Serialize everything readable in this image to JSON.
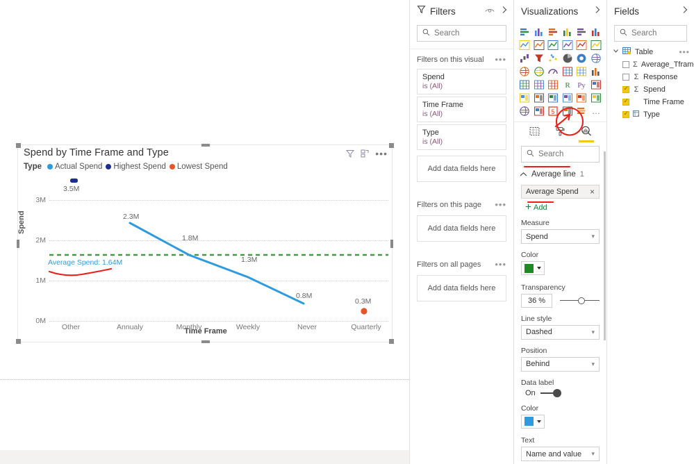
{
  "visual": {
    "title": "Spend by Time Frame and Type",
    "icons": {
      "filter": "filter-icon",
      "focus": "focus-mode-icon",
      "more": "more-options-icon"
    },
    "legend_title": "Type",
    "legend": [
      {
        "label": "Actual Spend",
        "color": "#2e9bde"
      },
      {
        "label": "Highest Spend",
        "color": "#1b2f91"
      },
      {
        "label": "Lowest Spend",
        "color": "#e8542a"
      }
    ],
    "average_line_label": "Average Spend: 1.64M"
  },
  "chart_data": {
    "type": "line",
    "title": "Spend by Time Frame and Type",
    "xlabel": "Time Frame",
    "ylabel": "Spend",
    "categories": [
      "Other",
      "Annualy",
      "Monthly",
      "Weekly",
      "Never",
      "Quarterly"
    ],
    "ylim": [
      0,
      3500000
    ],
    "yticks": [
      "0M",
      "1M",
      "2M",
      "3M"
    ],
    "grid": true,
    "legend_position": "top",
    "series": [
      {
        "name": "Actual Spend",
        "color": "#2e9bde",
        "points": [
          {
            "x": "Annualy",
            "value": 2300000,
            "label": "2.3M"
          },
          {
            "x": "Monthly",
            "value": 1800000,
            "label": "1.8M"
          },
          {
            "x": "Weekly",
            "value": 1300000,
            "label": "1.3M"
          },
          {
            "x": "Never",
            "value": 800000,
            "label": "0.8M"
          }
        ]
      },
      {
        "name": "Highest Spend",
        "color": "#1b2f91",
        "points": [
          {
            "x": "Other",
            "value": 3500000,
            "label": "3.5M"
          }
        ]
      },
      {
        "name": "Lowest Spend",
        "color": "#e8542a",
        "points": [
          {
            "x": "Quarterly",
            "value": 300000,
            "label": "0.3M"
          }
        ]
      }
    ],
    "reference_line": {
      "name": "Average Spend",
      "value": 1640000,
      "label": "Average Spend: 1.64M",
      "color": "#3aa03a",
      "style": "Dashed"
    }
  },
  "filters_pane": {
    "title": "Filters",
    "search_placeholder": "Search",
    "sections": [
      {
        "heading": "Filters on this visual",
        "cards": [
          {
            "name": "Spend",
            "value": "is (All)"
          },
          {
            "name": "Time Frame",
            "value": "is (All)"
          },
          {
            "name": "Type",
            "value": "is (All)"
          }
        ],
        "dropzone": "Add data fields here"
      },
      {
        "heading": "Filters on this page",
        "cards": [],
        "dropzone": "Add data fields here"
      },
      {
        "heading": "Filters on all pages",
        "cards": [],
        "dropzone": "Add data fields here"
      }
    ]
  },
  "viz_pane": {
    "title": "Visualizations",
    "search_placeholder": "Search",
    "icons": [
      "stacked-bar-chart-icon",
      "stacked-column-chart-icon",
      "clustered-bar-chart-icon",
      "clustered-column-chart-icon",
      "100-stacked-bar-chart-icon",
      "100-stacked-column-chart-icon",
      "line-chart-icon",
      "area-chart-icon",
      "stacked-area-chart-icon",
      "line-stacked-column-chart-icon",
      "line-clustered-column-chart-icon",
      "ribbon-chart-icon",
      "waterfall-chart-icon",
      "funnel-chart-icon",
      "scatter-chart-icon",
      "pie-chart-icon",
      "donut-chart-icon",
      "treemap-icon",
      "map-icon",
      "filled-map-icon",
      "gauge-icon",
      "card-icon",
      "multi-row-card-icon",
      "kpi-icon",
      "slicer-icon",
      "table-icon",
      "matrix-icon",
      "r-script-visual-icon",
      "python-visual-icon",
      "decomposition-tree-icon",
      "key-influencers-icon",
      "q-and-a-icon",
      "smart-narrative-icon",
      "paginated-report-icon",
      "power-apps-icon",
      "power-automate-icon",
      "arcgis-maps-icon",
      "visio-visual-icon",
      "html-viewer-icon",
      "charticulator-icon",
      "bullet-chart-icon",
      "more-visuals-icon"
    ],
    "tabs": [
      {
        "name": "fields-tab",
        "icon": "fields-grid-icon",
        "selected": false
      },
      {
        "name": "format-tab",
        "icon": "paint-roller-icon",
        "selected": false
      },
      {
        "name": "analytics-tab",
        "icon": "magnifier-analytics-icon",
        "selected": true
      }
    ],
    "accordion": {
      "label": "Average line",
      "count": "1"
    },
    "chip": {
      "label": "Average Spend",
      "remove": "×"
    },
    "add_label": "Add",
    "properties": [
      {
        "key": "measure",
        "label": "Measure",
        "type": "select",
        "value": "Spend"
      },
      {
        "key": "color",
        "label": "Color",
        "type": "color",
        "value": "#1f8a1f"
      },
      {
        "key": "transparency",
        "label": "Transparency",
        "type": "slider",
        "value": "36",
        "unit": "%"
      },
      {
        "key": "line_style",
        "label": "Line style",
        "type": "select",
        "value": "Dashed"
      },
      {
        "key": "position",
        "label": "Position",
        "type": "select",
        "value": "Behind"
      },
      {
        "key": "data_label",
        "label": "Data label",
        "type": "toggle",
        "value": "On"
      },
      {
        "key": "data_label_color",
        "label": "Color",
        "type": "color",
        "value": "#2e9bde"
      },
      {
        "key": "text",
        "label": "Text",
        "type": "select",
        "value": "Name and value"
      }
    ]
  },
  "fields_pane": {
    "title": "Fields",
    "search_placeholder": "Search",
    "table": {
      "name": "Table",
      "expanded": true
    },
    "fields": [
      {
        "label": "Average_Tframe",
        "checked": false,
        "agg": true,
        "icon": "sigma-icon"
      },
      {
        "label": "Response",
        "checked": false,
        "agg": true,
        "icon": "sigma-icon"
      },
      {
        "label": "Spend",
        "checked": true,
        "agg": true,
        "icon": "sigma-icon"
      },
      {
        "label": "Time Frame",
        "checked": true,
        "agg": false,
        "icon": ""
      },
      {
        "label": "Type",
        "checked": true,
        "agg": false,
        "icon": "hierarchy-icon"
      }
    ]
  },
  "annotations": {
    "color": "#e8221a",
    "marks": [
      "circle-around-analytics-tab",
      "underline-average-line",
      "underline-add-button",
      "squiggle-under-average-spend-label",
      "arrow-to-bullet-chart-icon"
    ]
  }
}
